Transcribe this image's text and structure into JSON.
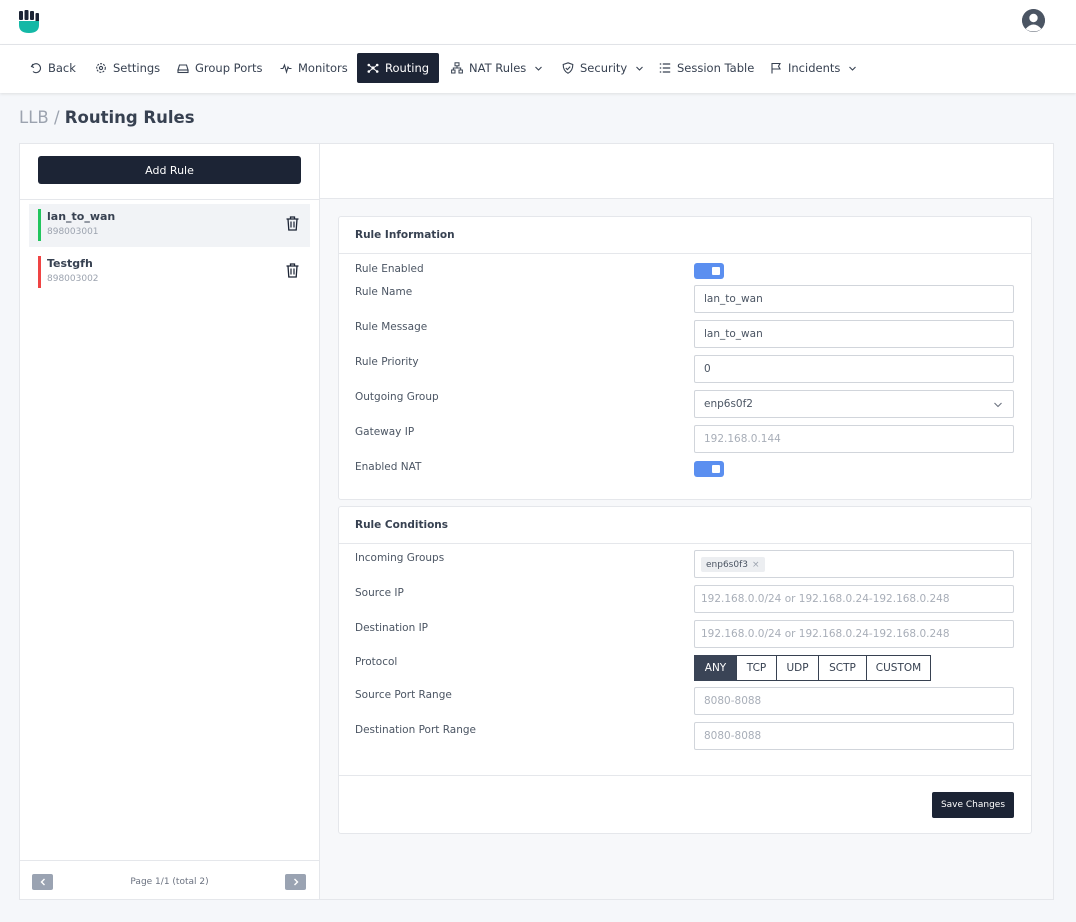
{
  "nav": {
    "items": [
      {
        "label": "Back",
        "icon": "undo-icon"
      },
      {
        "label": "Settings",
        "icon": "gear-icon"
      },
      {
        "label": "Group Ports",
        "icon": "hdd-icon"
      },
      {
        "label": "Monitors",
        "icon": "pulse-icon"
      },
      {
        "label": "Routing",
        "icon": "network-icon",
        "active": true
      },
      {
        "label": "NAT Rules",
        "icon": "sitemap-icon",
        "dropdown": true
      },
      {
        "label": "Security",
        "icon": "shield-check-icon",
        "dropdown": true
      },
      {
        "label": "Session Table",
        "icon": "list-icon"
      },
      {
        "label": "Incidents",
        "icon": "flag-icon",
        "dropdown": true
      }
    ]
  },
  "breadcrumb": {
    "root": "LLB",
    "separator": "/",
    "current": "Routing Rules"
  },
  "sidebar": {
    "add_label": "Add Rule",
    "rules": [
      {
        "name": "lan_to_wan",
        "id": "898003001",
        "status_color": "#22c55e",
        "selected": true
      },
      {
        "name": "Testgfh",
        "id": "898003002",
        "status_color": "#ef4444",
        "selected": false
      }
    ],
    "pagination": "Page 1/1 (total 2)"
  },
  "rule_info": {
    "title": "Rule Information",
    "enabled_label": "Rule Enabled",
    "enabled": true,
    "name_label": "Rule Name",
    "name_value": "lan_to_wan",
    "message_label": "Rule Message",
    "message_value": "lan_to_wan",
    "priority_label": "Rule Priority",
    "priority_value": "0",
    "outgoing_label": "Outgoing Group",
    "outgoing_value": "enp6s0f2",
    "gateway_label": "Gateway IP",
    "gateway_placeholder": "192.168.0.144",
    "nat_label": "Enabled NAT",
    "nat_enabled": true
  },
  "rule_conditions": {
    "title": "Rule Conditions",
    "incoming_label": "Incoming Groups",
    "incoming_tags": [
      "enp6s0f3"
    ],
    "tag_remove": "×",
    "source_ip_label": "Source IP",
    "source_ip_placeholder": "192.168.0.0/24 or 192.168.0.24-192.168.0.248",
    "dest_ip_label": "Destination IP",
    "dest_ip_placeholder": "192.168.0.0/24 or 192.168.0.24-192.168.0.248",
    "protocol_label": "Protocol",
    "protocols": [
      "ANY",
      "TCP",
      "UDP",
      "SCTP",
      "CUSTOM"
    ],
    "protocol_selected": "ANY",
    "source_port_label": "Source Port Range",
    "source_port_placeholder": "8080-8088",
    "dest_port_label": "Destination Port Range",
    "dest_port_placeholder": "8080-8088",
    "save_label": "Save Changes"
  },
  "colors": {
    "primary": "#1c2435",
    "toggle": "#5b8ff0",
    "logo": "#14b8a6"
  }
}
